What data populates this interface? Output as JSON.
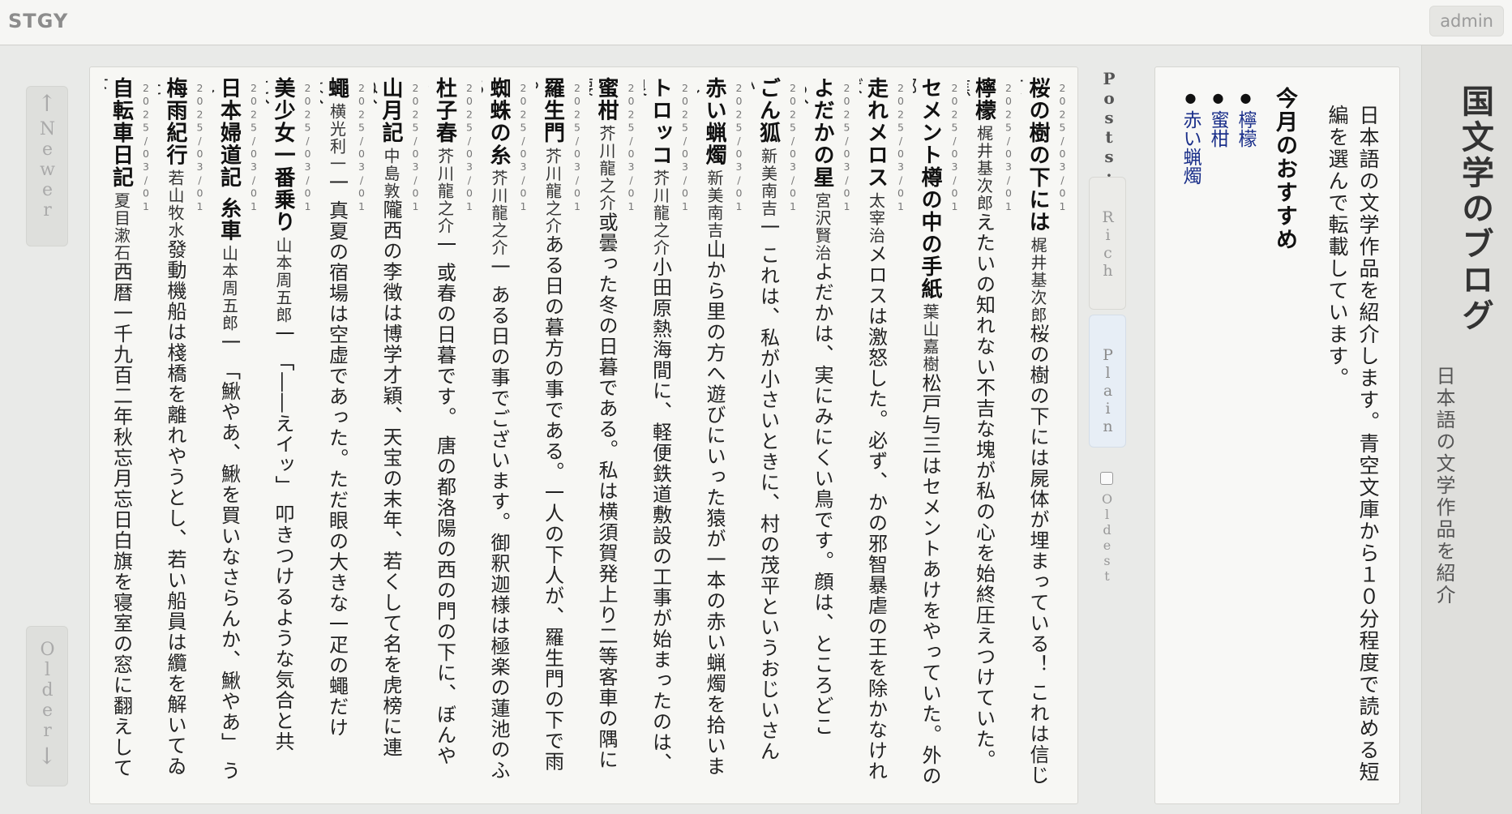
{
  "header": {
    "logo": "STGY",
    "admin_label": "admin"
  },
  "nav": {
    "newer_arrow": "↑",
    "newer_label": "Newer",
    "older_label": "Older",
    "older_arrow": "↓"
  },
  "controls": {
    "posts_label": "Posts:",
    "rich_label": "Rich",
    "plain_label": "Plain",
    "oldest_label": "Oldest",
    "selected_mode": "Plain"
  },
  "posts": [
    {
      "date": "2025/03/01",
      "title": "桜の樹の下には",
      "author": "梶井基次郎",
      "snippet": "桜の樹の下には屍体が埋まっている！ これは信じて…"
    },
    {
      "date": "2025/03/01",
      "title": "檸檬",
      "author": "梶井基次郎",
      "snippet": "えたいの知れない不吉な塊が私の心を始終圧えつけていた。焦…"
    },
    {
      "date": "2025/03/01",
      "title": "セメント樽の中の手紙",
      "author": "葉山嘉樹",
      "snippet": "松戸与三はセメントあけをやっていた。外の部…"
    },
    {
      "date": "2025/03/01",
      "title": "走れメロス",
      "author": "太宰治",
      "snippet": "メロスは激怒した。必ず、かの邪智暴虐の王を除かなければ…"
    },
    {
      "date": "2025/03/01",
      "title": "よだかの星",
      "author": "宮沢賢治",
      "snippet": "よだかは、実にみにくい鳥です。顔は、ところどころ、…"
    },
    {
      "date": "2025/03/01",
      "title": "ごん狐",
      "author": "新美南吉",
      "snippet": "一 これは、私が小さいときに、村の茂平というおじいさんか…"
    },
    {
      "date": "2025/03/01",
      "title": "赤い蝋燭",
      "author": "新美南吉",
      "snippet": "山から里の方へ遊びにいった猿が一本の赤い蝋燭を拾いまし…"
    },
    {
      "date": "2025/03/01",
      "title": "トロッコ",
      "author": "芥川龍之介",
      "snippet": "小田原熱海間に、軽便鉄道敷設の工事が始まったのは、良…"
    },
    {
      "date": "2025/03/01",
      "title": "蜜柑",
      "author": "芥川龍之介",
      "snippet": "或曇った冬の日暮である。私は横須賀発上り二等客車の隅に腰…"
    },
    {
      "date": "2025/03/01",
      "title": "羅生門",
      "author": "芥川龍之介",
      "snippet": "ある日の暮方の事である。一人の下人が、羅生門の下で雨や…"
    },
    {
      "date": "2025/03/01",
      "title": "蜘蛛の糸",
      "author": "芥川龍之介",
      "snippet": "一 ある日の事でございます。御釈迦様は極楽の蓮池のふち…"
    },
    {
      "date": "2025/03/01",
      "title": "杜子春",
      "author": "芥川龍之介",
      "snippet": "一 或春の日暮です。 唐の都洛陽の西の門の下に、ぼんやり…"
    },
    {
      "date": "2025/03/01",
      "title": "山月記",
      "author": "中島敦",
      "snippet": "隴西の李徴は博学才穎、天宝の末年、若くして名を虎榜に連ね、…"
    },
    {
      "date": "2025/03/01",
      "title": "蠅",
      "author": "横光利一",
      "snippet": "一 真夏の宿場は空虚であった。ただ眼の大きな一疋の蠅だけは、…"
    },
    {
      "date": "2025/03/01",
      "title": "美少女一番乗り",
      "author": "山本周五郎",
      "snippet": "一 「――えイッ」 叩きつけるような気合と共に、…"
    },
    {
      "date": "2025/03/01",
      "title": "日本婦道記 糸車",
      "author": "山本周五郎",
      "snippet": "一 「鰍やあ、鰍を買いなさらんか、鰍やあ」 うし…"
    },
    {
      "date": "2025/03/01",
      "title": "梅雨紀行",
      "author": "若山牧水",
      "snippet": "發動機船は棧橋を離れやうとし、若い船員は纜を解いてゐた…"
    },
    {
      "date": "2025/03/01",
      "title": "自転車日記",
      "author": "夏目漱石",
      "snippet": "西暦一千九百二年秋忘月忘日白旗を寝室の窓に翻えして下…"
    }
  ],
  "info": {
    "description": "日本語の文学作品を紹介します。青空文庫から１０分程度で読める短編を選んで転載しています。",
    "recommend_heading": "今月のおすすめ",
    "recommendations": [
      "檸檬",
      "蜜柑",
      "赤い蝋燭"
    ]
  },
  "site": {
    "title": "国文学のブログ",
    "subtitle": "日本語の文学作品を紹介"
  },
  "colors": {
    "link": "#1a2f8a",
    "background": "#e9eae8",
    "panel": "#f7f7f4"
  }
}
